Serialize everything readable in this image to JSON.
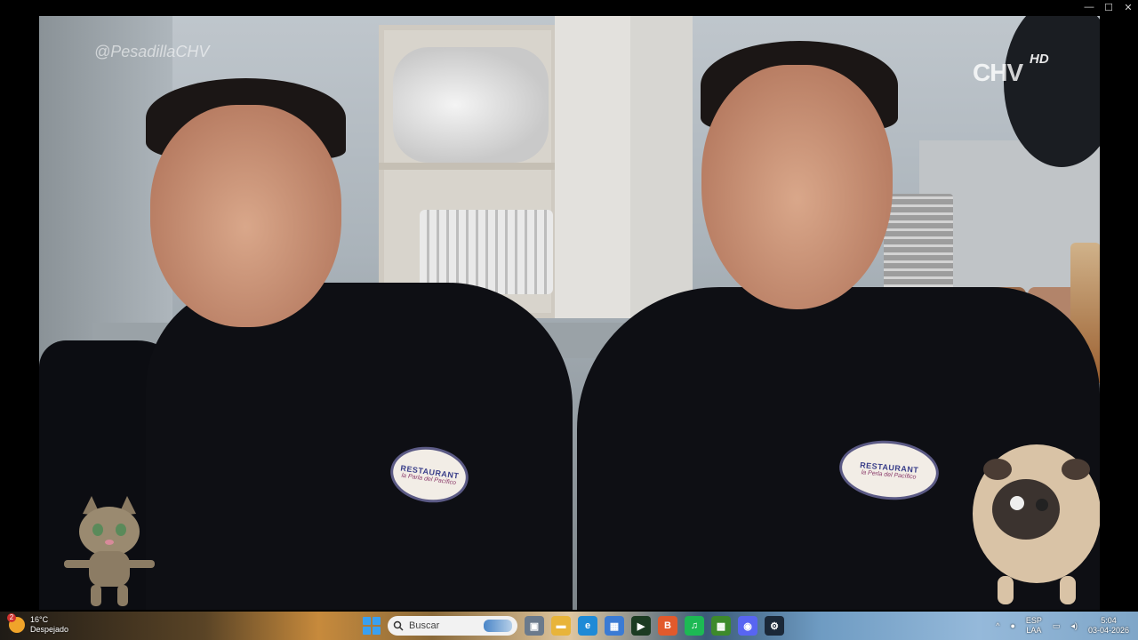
{
  "video": {
    "watermark": "@PesadillaCHV",
    "channel_logo": "CHV",
    "quality_badge": "HD",
    "badge_left": {
      "title": "RESTAURANT",
      "sub": "la Parla del Pacífico"
    },
    "badge_right": {
      "title": "RESTAURANT",
      "sub": "la Perla del Pacífico"
    }
  },
  "window_controls": {
    "minimize": "—",
    "maximize": "☐",
    "close": "✕"
  },
  "taskbar": {
    "weather": {
      "badge": "2",
      "temp": "16°C",
      "condition": "Despejado"
    },
    "search": {
      "placeholder": "Buscar"
    },
    "apps": [
      {
        "name": "task-view",
        "glyph": "▣",
        "color": "#6b7a8c"
      },
      {
        "name": "file-explorer",
        "glyph": "▬",
        "color": "#e8b43a"
      },
      {
        "name": "edge",
        "glyph": "e",
        "color": "#1f8ad6"
      },
      {
        "name": "store",
        "glyph": "▦",
        "color": "#3b7bd4"
      },
      {
        "name": "media-app",
        "glyph": "▶",
        "color": "#1c3b22"
      },
      {
        "name": "brave",
        "glyph": "B",
        "color": "#e25a2c"
      },
      {
        "name": "spotify",
        "glyph": "♫",
        "color": "#1db954"
      },
      {
        "name": "minecraft",
        "glyph": "▩",
        "color": "#3d8a2b"
      },
      {
        "name": "discord",
        "glyph": "◉",
        "color": "#5865f2"
      },
      {
        "name": "steam",
        "glyph": "⚙",
        "color": "#1b2838"
      }
    ],
    "tray": {
      "lang_top": "ESP",
      "lang_bottom": "LAA",
      "time": "5:04",
      "date": "03-04-2026"
    }
  }
}
